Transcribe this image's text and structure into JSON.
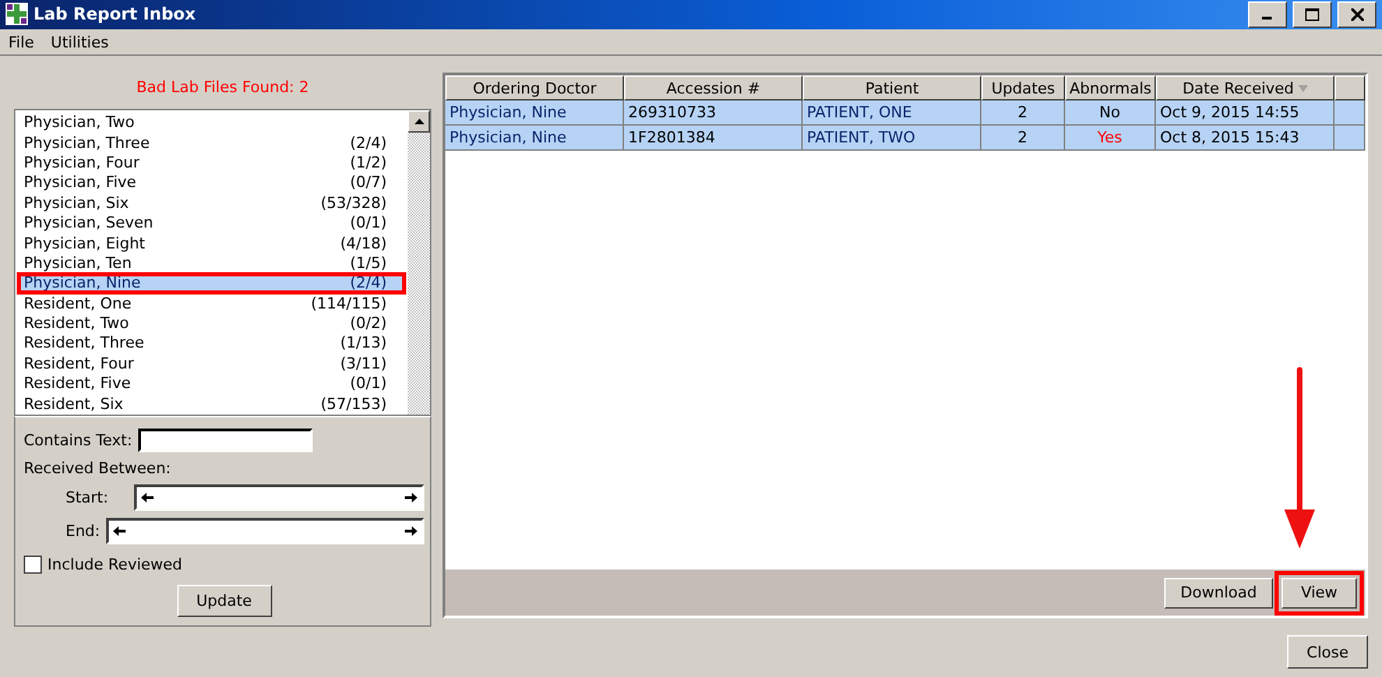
{
  "window": {
    "title": "Lab Report Inbox"
  },
  "menu": [
    "File",
    "Utilities"
  ],
  "bad_files": "Bad Lab Files Found: 2",
  "doctors": [
    {
      "name": "Physician, Two",
      "selected": false
    },
    {
      "name": "Physician, Three",
      "count": "(2/4)",
      "selected": false
    },
    {
      "name": "Physician, Four",
      "count": "(1/2)",
      "selected": false
    },
    {
      "name": "Physician, Five",
      "count": "(0/7)",
      "selected": false
    },
    {
      "name": "Physician, Six",
      "count": "(53/328)",
      "selected": false
    },
    {
      "name": "Physician, Seven",
      "count": "(0/1)",
      "selected": false
    },
    {
      "name": "Physician, Eight",
      "count": "(4/18)",
      "selected": false
    },
    {
      "name": "Physician, Ten",
      "count": "(1/5)",
      "selected": false
    },
    {
      "name": "Physician, Nine",
      "count": "(2/4)",
      "selected": true
    },
    {
      "name": "Resident, One",
      "count": "(114/115)",
      "selected": false
    },
    {
      "name": "Resident, Two",
      "count": "(0/2)",
      "selected": false
    },
    {
      "name": "Resident, Three",
      "count": "(1/13)",
      "selected": false
    },
    {
      "name": "Resident, Four",
      "count": "(3/11)",
      "selected": false
    },
    {
      "name": "Resident, Five",
      "count": "(0/1)",
      "selected": false
    },
    {
      "name": "Resident, Six",
      "count": "(57/153)",
      "selected": false
    }
  ],
  "filters": {
    "contains_label": "Contains Text:",
    "received_label": "Received Between:",
    "start_label": "Start:",
    "end_label": "End:",
    "include_reviewed": {
      "label": "Include Reviewed",
      "checked": false
    },
    "update_button": "Update"
  },
  "table": {
    "columns": [
      "Ordering Doctor",
      "Accession #",
      "Patient",
      "Updates",
      "Abnormals",
      "Date Received"
    ],
    "rows": [
      {
        "doctor": "Physician, Nine",
        "accession": "269310733",
        "patient": "PATIENT, ONE",
        "updates": "2",
        "abnormals": "No",
        "abnormal": false,
        "date": "Oct 9, 2015 14:55",
        "selected": true
      },
      {
        "doctor": "Physician, Nine",
        "accession": "1F2801384",
        "patient": "PATIENT, TWO",
        "updates": "2",
        "abnormals": "Yes",
        "abnormal": true,
        "date": "Oct 8, 2015 15:43",
        "selected": true
      }
    ]
  },
  "buttons": [
    "Download",
    "View"
  ],
  "close_button": "Close"
}
